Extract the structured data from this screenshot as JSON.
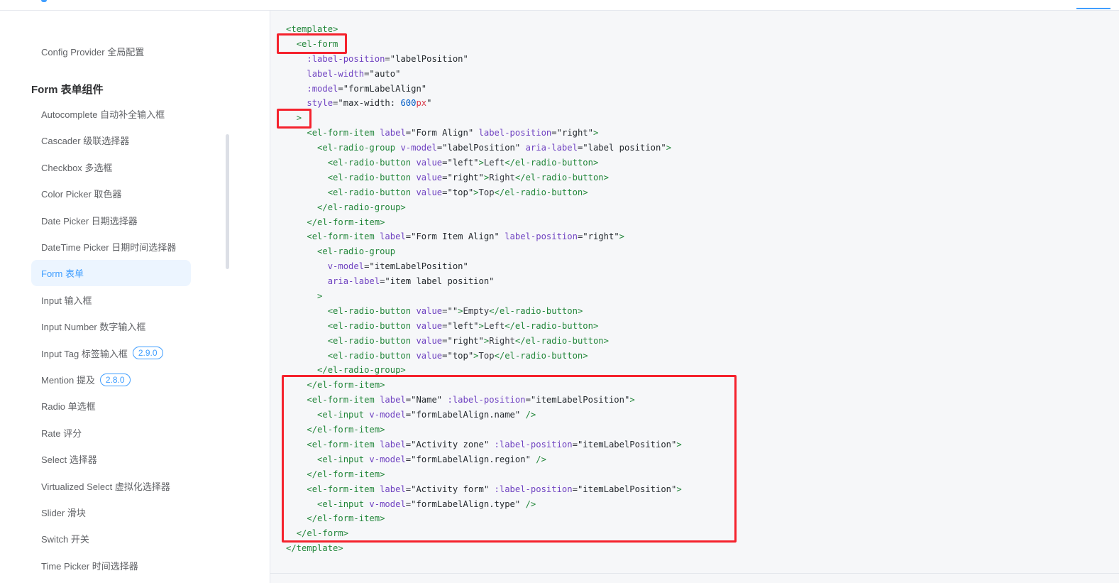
{
  "sidebar": {
    "config_item": "Config Provider 全局配置",
    "group_title": "Form 表单组件",
    "items": [
      {
        "label": "Autocomplete 自动补全输入框",
        "badge": null,
        "active": false
      },
      {
        "label": "Cascader 级联选择器",
        "badge": null,
        "active": false
      },
      {
        "label": "Checkbox 多选框",
        "badge": null,
        "active": false
      },
      {
        "label": "Color Picker 取色器",
        "badge": null,
        "active": false
      },
      {
        "label": "Date Picker 日期选择器",
        "badge": null,
        "active": false
      },
      {
        "label": "DateTime Picker 日期时间选择器",
        "badge": null,
        "active": false
      },
      {
        "label": "Form 表单",
        "badge": null,
        "active": true
      },
      {
        "label": "Input 输入框",
        "badge": null,
        "active": false
      },
      {
        "label": "Input Number 数字输入框",
        "badge": null,
        "active": false
      },
      {
        "label": "Input Tag 标签输入框",
        "badge": "2.9.0",
        "active": false
      },
      {
        "label": "Mention 提及",
        "badge": "2.8.0",
        "active": false
      },
      {
        "label": "Radio 单选框",
        "badge": null,
        "active": false
      },
      {
        "label": "Rate 评分",
        "badge": null,
        "active": false
      },
      {
        "label": "Select 选择器",
        "badge": null,
        "active": false
      },
      {
        "label": "Virtualized Select 虚拟化选择器",
        "badge": null,
        "active": false
      },
      {
        "label": "Slider 滑块",
        "badge": null,
        "active": false
      },
      {
        "label": "Switch 开关",
        "badge": null,
        "active": false
      },
      {
        "label": "Time Picker 时间选择器",
        "badge": null,
        "active": false
      }
    ]
  },
  "code": {
    "lines": [
      [
        [
          "tag",
          "<template>"
        ]
      ],
      [
        [
          "p",
          "  "
        ],
        [
          "tag",
          "<el-form"
        ]
      ],
      [
        [
          "p",
          "    "
        ],
        [
          "attr",
          ":label-position"
        ],
        [
          "p",
          "="
        ],
        [
          "str",
          "\"labelPosition\""
        ]
      ],
      [
        [
          "p",
          "    "
        ],
        [
          "attr",
          "label-width"
        ],
        [
          "p",
          "="
        ],
        [
          "str",
          "\"auto\""
        ]
      ],
      [
        [
          "p",
          "    "
        ],
        [
          "attr",
          ":model"
        ],
        [
          "p",
          "="
        ],
        [
          "str",
          "\"formLabelAlign\""
        ]
      ],
      [
        [
          "p",
          "    "
        ],
        [
          "attr",
          "style"
        ],
        [
          "p",
          "="
        ],
        [
          "str",
          "\"max-width: "
        ],
        [
          "num",
          "600"
        ],
        [
          "unit",
          "px"
        ],
        [
          "str",
          "\""
        ]
      ],
      [
        [
          "p",
          "  "
        ],
        [
          "tag",
          ">"
        ]
      ],
      [
        [
          "p",
          "    "
        ],
        [
          "tag",
          "<el-form-item"
        ],
        [
          "p",
          " "
        ],
        [
          "attr",
          "label"
        ],
        [
          "p",
          "="
        ],
        [
          "str",
          "\"Form Align\""
        ],
        [
          "p",
          " "
        ],
        [
          "attr",
          "label-position"
        ],
        [
          "p",
          "="
        ],
        [
          "str",
          "\"right\""
        ],
        [
          "tag",
          ">"
        ]
      ],
      [
        [
          "p",
          "      "
        ],
        [
          "tag",
          "<el-radio-group"
        ],
        [
          "p",
          " "
        ],
        [
          "attr",
          "v-model"
        ],
        [
          "p",
          "="
        ],
        [
          "str",
          "\"labelPosition\""
        ],
        [
          "p",
          " "
        ],
        [
          "attr",
          "aria-label"
        ],
        [
          "p",
          "="
        ],
        [
          "str",
          "\"label position\""
        ],
        [
          "tag",
          ">"
        ]
      ],
      [
        [
          "p",
          "        "
        ],
        [
          "tag",
          "<el-radio-button"
        ],
        [
          "p",
          " "
        ],
        [
          "attr",
          "value"
        ],
        [
          "p",
          "="
        ],
        [
          "str",
          "\"left\""
        ],
        [
          "tag",
          ">"
        ],
        [
          "p",
          "Left"
        ],
        [
          "tag",
          "</el-radio-button>"
        ]
      ],
      [
        [
          "p",
          "        "
        ],
        [
          "tag",
          "<el-radio-button"
        ],
        [
          "p",
          " "
        ],
        [
          "attr",
          "value"
        ],
        [
          "p",
          "="
        ],
        [
          "str",
          "\"right\""
        ],
        [
          "tag",
          ">"
        ],
        [
          "p",
          "Right"
        ],
        [
          "tag",
          "</el-radio-button>"
        ]
      ],
      [
        [
          "p",
          "        "
        ],
        [
          "tag",
          "<el-radio-button"
        ],
        [
          "p",
          " "
        ],
        [
          "attr",
          "value"
        ],
        [
          "p",
          "="
        ],
        [
          "str",
          "\"top\""
        ],
        [
          "tag",
          ">"
        ],
        [
          "p",
          "Top"
        ],
        [
          "tag",
          "</el-radio-button>"
        ]
      ],
      [
        [
          "p",
          "      "
        ],
        [
          "tag",
          "</el-radio-group>"
        ]
      ],
      [
        [
          "p",
          "    "
        ],
        [
          "tag",
          "</el-form-item>"
        ]
      ],
      [
        [
          "p",
          "    "
        ],
        [
          "tag",
          "<el-form-item"
        ],
        [
          "p",
          " "
        ],
        [
          "attr",
          "label"
        ],
        [
          "p",
          "="
        ],
        [
          "str",
          "\"Form Item Align\""
        ],
        [
          "p",
          " "
        ],
        [
          "attr",
          "label-position"
        ],
        [
          "p",
          "="
        ],
        [
          "str",
          "\"right\""
        ],
        [
          "tag",
          ">"
        ]
      ],
      [
        [
          "p",
          "      "
        ],
        [
          "tag",
          "<el-radio-group"
        ]
      ],
      [
        [
          "p",
          "        "
        ],
        [
          "attr",
          "v-model"
        ],
        [
          "p",
          "="
        ],
        [
          "str",
          "\"itemLabelPosition\""
        ]
      ],
      [
        [
          "p",
          "        "
        ],
        [
          "attr",
          "aria-label"
        ],
        [
          "p",
          "="
        ],
        [
          "str",
          "\"item label position\""
        ]
      ],
      [
        [
          "p",
          "      "
        ],
        [
          "tag",
          ">"
        ]
      ],
      [
        [
          "p",
          "        "
        ],
        [
          "tag",
          "<el-radio-button"
        ],
        [
          "p",
          " "
        ],
        [
          "attr",
          "value"
        ],
        [
          "p",
          "="
        ],
        [
          "str",
          "\"\""
        ],
        [
          "tag",
          ">"
        ],
        [
          "p",
          "Empty"
        ],
        [
          "tag",
          "</el-radio-button>"
        ]
      ],
      [
        [
          "p",
          "        "
        ],
        [
          "tag",
          "<el-radio-button"
        ],
        [
          "p",
          " "
        ],
        [
          "attr",
          "value"
        ],
        [
          "p",
          "="
        ],
        [
          "str",
          "\"left\""
        ],
        [
          "tag",
          ">"
        ],
        [
          "p",
          "Left"
        ],
        [
          "tag",
          "</el-radio-button>"
        ]
      ],
      [
        [
          "p",
          "        "
        ],
        [
          "tag",
          "<el-radio-button"
        ],
        [
          "p",
          " "
        ],
        [
          "attr",
          "value"
        ],
        [
          "p",
          "="
        ],
        [
          "str",
          "\"right\""
        ],
        [
          "tag",
          ">"
        ],
        [
          "p",
          "Right"
        ],
        [
          "tag",
          "</el-radio-button>"
        ]
      ],
      [
        [
          "p",
          "        "
        ],
        [
          "tag",
          "<el-radio-button"
        ],
        [
          "p",
          " "
        ],
        [
          "attr",
          "value"
        ],
        [
          "p",
          "="
        ],
        [
          "str",
          "\"top\""
        ],
        [
          "tag",
          ">"
        ],
        [
          "p",
          "Top"
        ],
        [
          "tag",
          "</el-radio-button>"
        ]
      ],
      [
        [
          "p",
          "      "
        ],
        [
          "tag",
          "</el-radio-group>"
        ]
      ],
      [
        [
          "p",
          "    "
        ],
        [
          "tag",
          "</el-form-item>"
        ]
      ],
      [
        [
          "p",
          "    "
        ],
        [
          "tag",
          "<el-form-item"
        ],
        [
          "p",
          " "
        ],
        [
          "attr",
          "label"
        ],
        [
          "p",
          "="
        ],
        [
          "str",
          "\"Name\""
        ],
        [
          "p",
          " "
        ],
        [
          "attr",
          ":label-position"
        ],
        [
          "p",
          "="
        ],
        [
          "str",
          "\"itemLabelPosition\""
        ],
        [
          "tag",
          ">"
        ]
      ],
      [
        [
          "p",
          "      "
        ],
        [
          "tag",
          "<el-input"
        ],
        [
          "p",
          " "
        ],
        [
          "attr",
          "v-model"
        ],
        [
          "p",
          "="
        ],
        [
          "str",
          "\"formLabelAlign.name\""
        ],
        [
          "p",
          " "
        ],
        [
          "tag",
          "/>"
        ]
      ],
      [
        [
          "p",
          "    "
        ],
        [
          "tag",
          "</el-form-item>"
        ]
      ],
      [
        [
          "p",
          "    "
        ],
        [
          "tag",
          "<el-form-item"
        ],
        [
          "p",
          " "
        ],
        [
          "attr",
          "label"
        ],
        [
          "p",
          "="
        ],
        [
          "str",
          "\"Activity zone\""
        ],
        [
          "p",
          " "
        ],
        [
          "attr",
          ":label-position"
        ],
        [
          "p",
          "="
        ],
        [
          "str",
          "\"itemLabelPosition\""
        ],
        [
          "tag",
          ">"
        ]
      ],
      [
        [
          "p",
          "      "
        ],
        [
          "tag",
          "<el-input"
        ],
        [
          "p",
          " "
        ],
        [
          "attr",
          "v-model"
        ],
        [
          "p",
          "="
        ],
        [
          "str",
          "\"formLabelAlign.region\""
        ],
        [
          "p",
          " "
        ],
        [
          "tag",
          "/>"
        ]
      ],
      [
        [
          "p",
          "    "
        ],
        [
          "tag",
          "</el-form-item>"
        ]
      ],
      [
        [
          "p",
          "    "
        ],
        [
          "tag",
          "<el-form-item"
        ],
        [
          "p",
          " "
        ],
        [
          "attr",
          "label"
        ],
        [
          "p",
          "="
        ],
        [
          "str",
          "\"Activity form\""
        ],
        [
          "p",
          " "
        ],
        [
          "attr",
          ":label-position"
        ],
        [
          "p",
          "="
        ],
        [
          "str",
          "\"itemLabelPosition\""
        ],
        [
          "tag",
          ">"
        ]
      ],
      [
        [
          "p",
          "      "
        ],
        [
          "tag",
          "<el-input"
        ],
        [
          "p",
          " "
        ],
        [
          "attr",
          "v-model"
        ],
        [
          "p",
          "="
        ],
        [
          "str",
          "\"formLabelAlign.type\""
        ],
        [
          "p",
          " "
        ],
        [
          "tag",
          "/>"
        ]
      ],
      [
        [
          "p",
          "    "
        ],
        [
          "tag",
          "</el-form-item>"
        ]
      ],
      [
        [
          "p",
          "  "
        ],
        [
          "tag",
          "</el-form>"
        ]
      ],
      [
        [
          "tag",
          "</template>"
        ]
      ]
    ]
  },
  "colors": {
    "accent": "#409eff",
    "highlight": "#f5222d",
    "code_tag": "#22863a",
    "code_attr": "#6f42c1"
  }
}
